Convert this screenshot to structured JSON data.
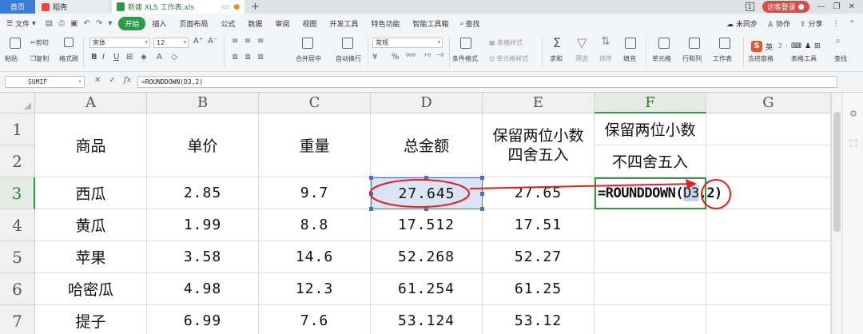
{
  "tabs": {
    "home": "首页",
    "docer": "稻壳",
    "file": "新建 XLS 工作表.xls",
    "page_indicator": "1",
    "guest_login": "访客登录"
  },
  "menubar": {
    "file_menu": "文件",
    "items": [
      "开始",
      "插入",
      "页面布局",
      "公式",
      "数据",
      "审阅",
      "视图",
      "开发工具",
      "特色功能",
      "智能工具箱"
    ],
    "search": "查找",
    "right": [
      "未同步",
      "协作",
      "分享"
    ]
  },
  "ribbon": {
    "cut": "剪切",
    "paste": "粘贴",
    "copy": "复制",
    "format_painter": "格式刷",
    "font_name": "宋体",
    "font_size": "12",
    "merge_center": "合并居中",
    "wrap_text": "自动换行",
    "number_format": "常规",
    "table_style": "表格样式",
    "cond_format": "条件格式",
    "cell_style": "单元格样式",
    "sum": "求和",
    "filter": "筛选",
    "sort": "排序",
    "fill": "填充",
    "cell": "单元格",
    "row_col": "行和列",
    "worksheet": "工作表",
    "freeze": "冻结窗格",
    "table_tools": "表格工具",
    "find": "查找",
    "ime_label": "英"
  },
  "formula_bar": {
    "name_box": "SUMIF",
    "fx": "fx",
    "formula": "=ROUNDDOWN(D3,2)"
  },
  "sheet": {
    "columns": [
      "A",
      "B",
      "C",
      "D",
      "E",
      "F",
      "G"
    ],
    "rows": [
      "1",
      "2",
      "3",
      "4",
      "5",
      "6",
      "7"
    ],
    "headers": {
      "a": "商品",
      "b": "单价",
      "c": "重量",
      "d": "总金额",
      "e": "保留两位小数四舍五入",
      "f1": "保留两位小数",
      "f2": "不四舍五入"
    },
    "data": [
      {
        "a": "西瓜",
        "b": "2.85",
        "c": "9.7",
        "d": "27.645",
        "e": "27.65"
      },
      {
        "a": "黄瓜",
        "b": "1.99",
        "c": "8.8",
        "d": "17.512",
        "e": "17.51"
      },
      {
        "a": "苹果",
        "b": "3.58",
        "c": "14.6",
        "d": "52.268",
        "e": "52.27"
      },
      {
        "a": "哈密瓜",
        "b": "4.98",
        "c": "12.3",
        "d": "61.254",
        "e": "61.25"
      },
      {
        "a": "提子",
        "b": "6.99",
        "c": "7.6",
        "d": "53.124",
        "e": "53.12"
      }
    ],
    "editing_cell": {
      "prefix": "=ROUNDDOWN(",
      "ref": "D3",
      "suffix": ",2)"
    }
  },
  "colors": {
    "accent_green": "#2e9a48",
    "selection_blue": "#4472c4",
    "annotation_red": "#e02020"
  }
}
